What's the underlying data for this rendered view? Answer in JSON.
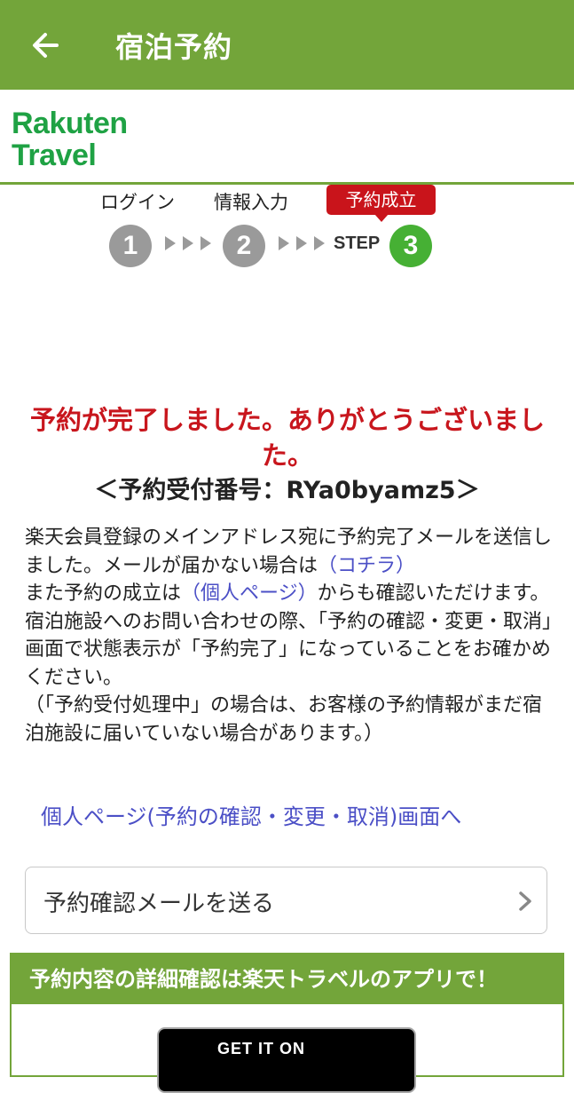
{
  "appbar": {
    "title": "宿泊予約",
    "back_icon": "back-arrow-icon"
  },
  "brand": {
    "logo_line1": "Rakuten",
    "logo_line2": "Travel",
    "color": "#1fa244"
  },
  "steps": {
    "step1_label": "ログイン",
    "step2_label": "情報入力",
    "step3_badge": "予約成立",
    "step1_number": "1",
    "step2_number": "2",
    "step3_number": "3",
    "step_word": "STEP",
    "current_color": "#46b034",
    "inactive_color": "#9a9a9a"
  },
  "main": {
    "complete_message": "予約が完了しました。ありがとうございました。",
    "reservation_number": "＜予約受付番号：RYa0byamz5＞",
    "info_part1": "楽天会員登録のメインアドレス宛に予約完了メールを送信しました。メールが届かない場合は",
    "info_link1": "（コチラ）",
    "info_part2": "また予約の成立は",
    "info_link2": "（個人ページ）",
    "info_part3": "からも確認いただけます。",
    "info_part4": "宿泊施設へのお問い合わせの際、「予約の確認・変更・取消」画面で状態表示が「予約完了」になっていることをお確かめください。",
    "info_part5": "（「予約受付処理中」の場合は、お客様の予約情報がまだ宿泊施設に届いていない場合があります。）",
    "mypage_link": "個人ページ(予約の確認・変更・取消)画面へ",
    "mail_button_label": "予約確認メールを送る"
  },
  "app_promo": {
    "header": "予約内容の詳細確認は楽天トラベルのアプリで！",
    "badge_text": "GET IT ON"
  },
  "colors": {
    "accent_green": "#73a53a",
    "alert_red": "#c8161d",
    "link_blue": "#4b4fc6"
  }
}
